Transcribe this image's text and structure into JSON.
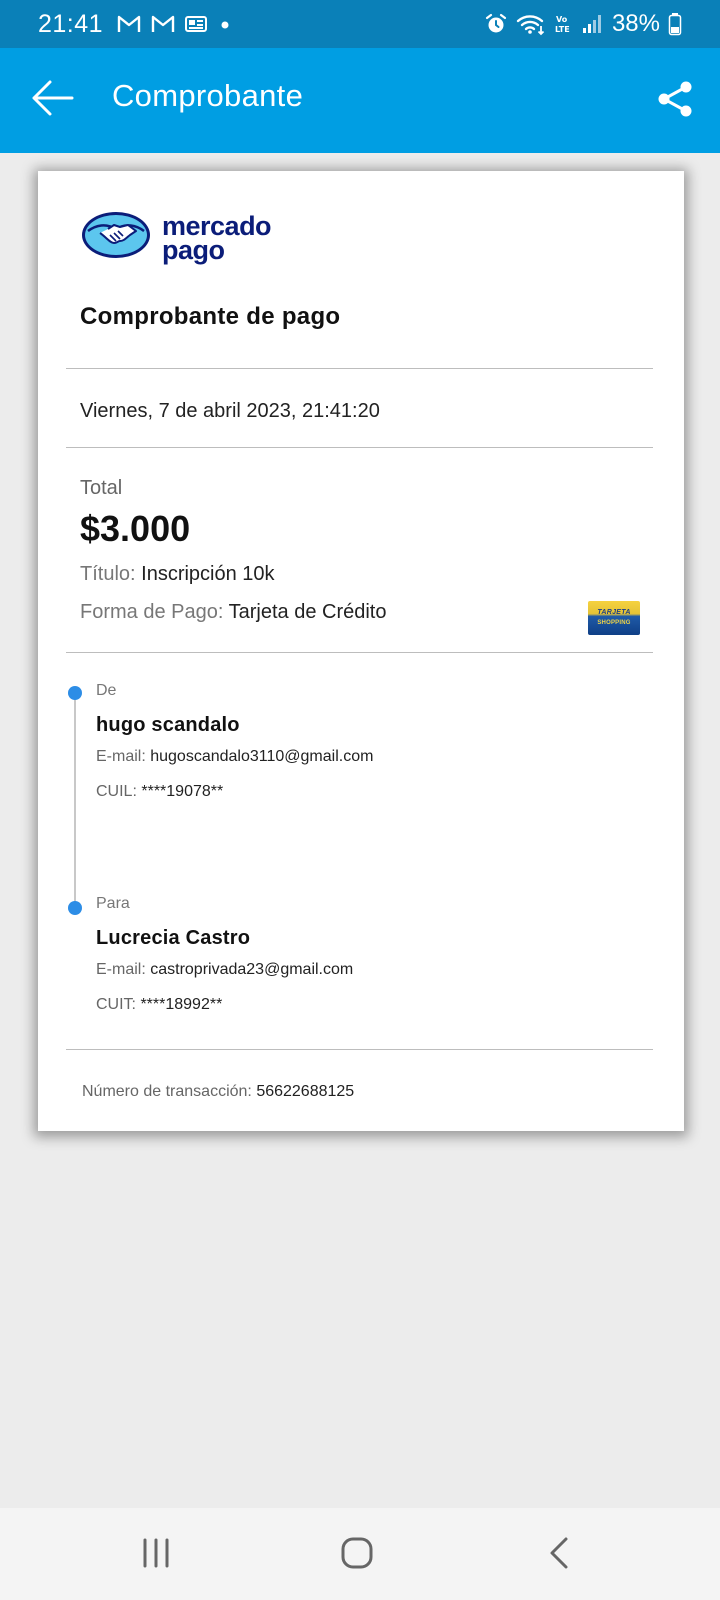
{
  "status_bar": {
    "time": "21:41",
    "battery": "38%",
    "icons": [
      "gmail-icon",
      "gmail-icon",
      "news-icon",
      "dot-icon",
      "alarm-icon",
      "wifi-icon",
      "volte-icon",
      "signal-icon",
      "battery-icon"
    ]
  },
  "app_bar": {
    "title": "Comprobante",
    "back_icon": "arrow-left-icon",
    "share_icon": "share-icon"
  },
  "receipt": {
    "logo": {
      "line1": "mercado",
      "line2": "pago"
    },
    "title": "Comprobante de pago",
    "date": "Viernes, 7 de abril 2023, 21:41:20",
    "total_label": "Total",
    "total_amount": "$3.000",
    "titulo_label": "Título:",
    "titulo_value": "Inscripción 10k",
    "forma_pago_label": "Forma de Pago:",
    "forma_pago_value": "Tarjeta de Crédito",
    "card_brand": {
      "top": "TARJETA",
      "bottom": "SHOPPING"
    },
    "from": {
      "label": "De",
      "name": "hugo scandalo",
      "email_label": "E-mail:",
      "email": "hugoscandalo3110@gmail.com",
      "id_label": "CUIL:",
      "id_value": "****19078**"
    },
    "to": {
      "label": "Para",
      "name": "Lucrecia Castro",
      "email_label": "E-mail:",
      "email": "castroprivada23@gmail.com",
      "id_label": "CUIT:",
      "id_value": "****18992**"
    },
    "transaction_label": "Número de transacción:",
    "transaction_value": "56622688125"
  },
  "nav_bar": {
    "icons": [
      "recent-apps-icon",
      "home-icon",
      "back-icon"
    ]
  },
  "colors": {
    "status_bar": "#0a80b8",
    "app_bar": "#009ee3",
    "timeline_dot": "#2d8de6",
    "brand_navy": "#0b1d79",
    "background": "#ececec"
  }
}
